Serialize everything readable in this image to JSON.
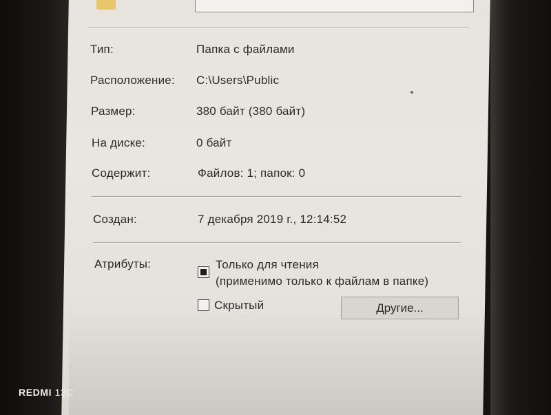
{
  "properties": {
    "type_label": "Тип:",
    "type_value": "Папка с файлами",
    "location_label": "Расположение:",
    "location_value": "C:\\Users\\Public",
    "size_label": "Размер:",
    "size_value": "380 байт (380 байт)",
    "on_disk_label": "На диске:",
    "on_disk_value": "0 байт",
    "contains_label": "Содержит:",
    "contains_value": "Файлов: 1; папок: 0",
    "created_label": "Создан:",
    "created_value": "7 декабря 2019 г., 12:14:52"
  },
  "attributes": {
    "label": "Атрибуты:",
    "readonly_label_line1": "Только для чтения",
    "readonly_label_line2": "(применимо только к файлам в папке)",
    "readonly_state": "indeterminate",
    "hidden_label": "Скрытый",
    "hidden_checked": false,
    "other_button": "Другие..."
  },
  "watermark": {
    "brand": "REDMI",
    "model": "13C"
  },
  "icons": {
    "folder": "folder-icon"
  },
  "colors": {
    "window_bg": "#e7e3de",
    "text": "#2b2a28",
    "button_bg": "#d9d5d0",
    "folder": "#e8c76a"
  }
}
